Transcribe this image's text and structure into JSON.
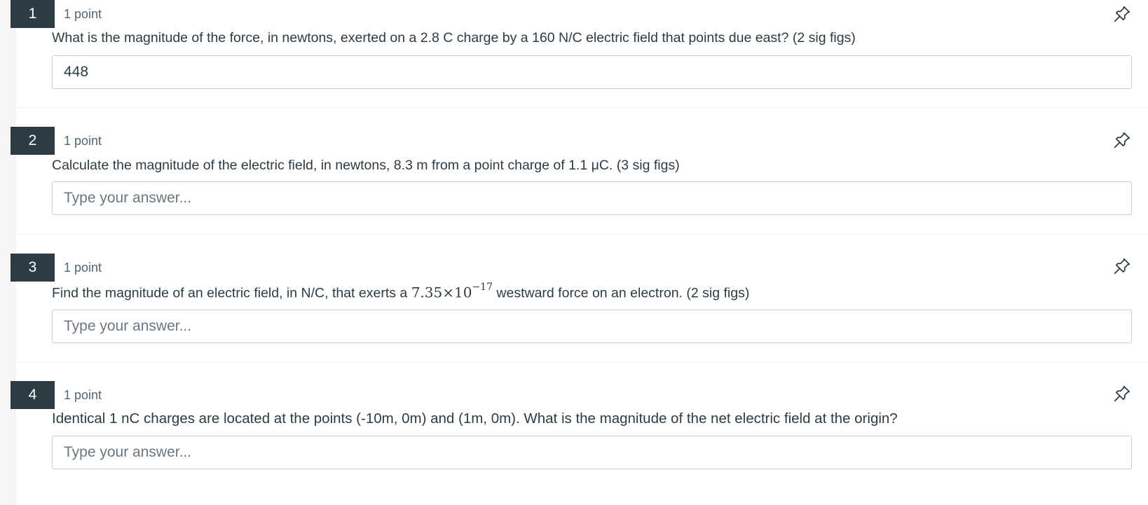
{
  "questions": [
    {
      "number": "1",
      "points": "1 point",
      "text": "What is the magnitude of the force, in newtons, exerted on a 2.8 C charge by a 160 N/C electric field that points due east? (2 sig figs)",
      "answer_value": "448",
      "placeholder": "Type your answer..."
    },
    {
      "number": "2",
      "points": "1 point",
      "text": "Calculate the magnitude of the electric field, in newtons, 8.3 m from a point charge of 1.1 μC. (3 sig figs)",
      "answer_value": "",
      "placeholder": "Type your answer..."
    },
    {
      "number": "3",
      "points": "1 point",
      "text_before": "Find the magnitude of an electric field, in N/C, that exerts a ",
      "math_base": "7.35×10",
      "math_exponent": "−17",
      "text_after": " westward force on an electron. (2 sig figs)",
      "answer_value": "",
      "placeholder": "Type your answer..."
    },
    {
      "number": "4",
      "points": "1 point",
      "text": "Identical 1 nC charges are located at the points (-10m, 0m) and (1m, 0m). What is the magnitude of the net electric field at the origin?",
      "answer_value": "",
      "placeholder": "Type your answer..."
    }
  ],
  "icons": {
    "pin": "pushpin-icon"
  },
  "colors": {
    "number_badge_bg": "#2d3b45",
    "text": "#2d3b45",
    "input_border": "#c7cdd1",
    "gutter": "#f5f5f5"
  }
}
